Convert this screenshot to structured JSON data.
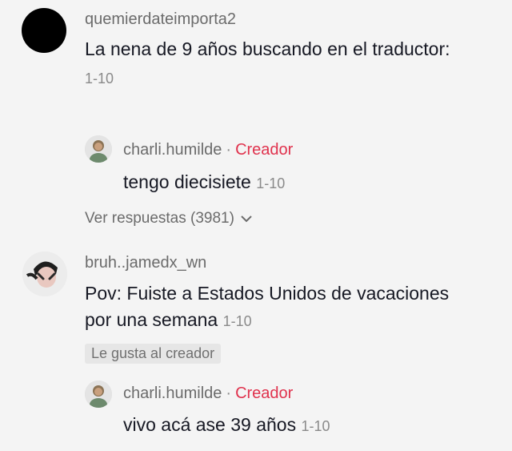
{
  "comments": [
    {
      "username": "quemierdateimporta2",
      "text": "La nena de 9 años buscando en el traductor:",
      "date": "1-10",
      "avatar_icon": "black-circle-avatar",
      "reply": {
        "username": "charli.humilde",
        "separator": "·",
        "creator_tag": "Creador",
        "text": "tengo diecisiete",
        "date": "1-10",
        "avatar_icon": "person-avatar"
      },
      "view_replies": "Ver respuestas (3981)"
    },
    {
      "username": "bruh..jamedx_wn",
      "text_line1": "Pov: Fuiste a Estados Unidos de vacaciones",
      "text_line2": "por una semana",
      "date": "1-10",
      "liked_by_creator": "Le gusta al creador",
      "avatar_icon": "person-avatar",
      "reply": {
        "username": "charli.humilde",
        "separator": "·",
        "creator_tag": "Creador",
        "text": "vivo acá ase 39 años",
        "date": "1-10",
        "avatar_icon": "person-avatar"
      }
    }
  ],
  "colors": {
    "background": "#f4f4f4",
    "creator": "#e0324d",
    "username": "#6b6b6b",
    "text": "#161823"
  }
}
